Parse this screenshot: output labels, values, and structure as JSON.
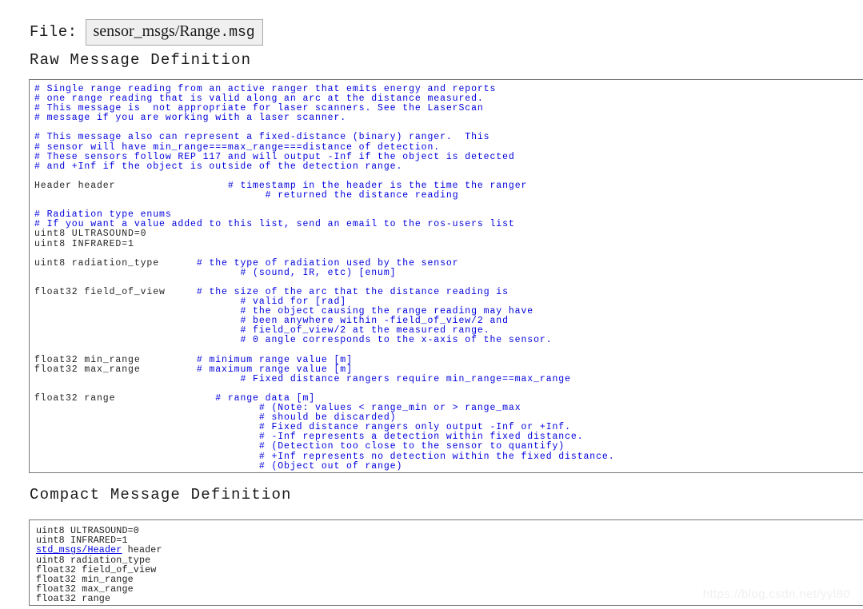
{
  "page": {
    "file_label": "File:",
    "file_name_stem": "sensor_msgs/Range",
    "file_name_ext": ".msg",
    "file_name_full": "sensor_msgs/Range.msg",
    "watermark": "https://blog.csdn.net/yyl80"
  },
  "colors": {
    "comment_blue": "#0000dd",
    "code_text": "#222222",
    "link_blue": "#0000dd",
    "box_border": "#777777",
    "file_box_bg": "#efefef",
    "file_box_border": "#a9a9a9",
    "watermark": "#f0f0f0",
    "page_bg": "#ffffff"
  },
  "sections": {
    "raw": {
      "heading": "Raw Message Definition",
      "lines": [
        {
          "code": "",
          "comment": "# Single range reading from an active ranger that emits energy and reports"
        },
        {
          "code": "",
          "comment": "# one range reading that is valid along an arc at the distance measured."
        },
        {
          "code": "",
          "comment": "# This message is  not appropriate for laser scanners. See the LaserScan"
        },
        {
          "code": "",
          "comment": "# message if you are working with a laser scanner."
        },
        {
          "code": "",
          "comment": ""
        },
        {
          "code": "",
          "comment": "# This message also can represent a fixed-distance (binary) ranger.  This"
        },
        {
          "code": "",
          "comment": "# sensor will have min_range===max_range===distance of detection."
        },
        {
          "code": "",
          "comment": "# These sensors follow REP 117 and will output -Inf if the object is detected"
        },
        {
          "code": "",
          "comment": "# and +Inf if the object is outside of the detection range."
        },
        {
          "code": "",
          "comment": ""
        },
        {
          "code": "Header header",
          "comment": "# timestamp in the header is the time the ranger"
        },
        {
          "code": "",
          "comment": "# returned the distance reading"
        },
        {
          "code": "",
          "comment": ""
        },
        {
          "code": "",
          "comment": "# Radiation type enums"
        },
        {
          "code": "",
          "comment": "# If you want a value added to this list, send an email to the ros-users list"
        },
        {
          "code": "uint8 ULTRASOUND=0",
          "comment": ""
        },
        {
          "code": "uint8 INFRARED=1",
          "comment": ""
        },
        {
          "code": "",
          "comment": ""
        },
        {
          "code": "uint8 radiation_type",
          "comment": "# the type of radiation used by the sensor"
        },
        {
          "code": "",
          "comment": "# (sound, IR, etc) [enum]"
        },
        {
          "code": "",
          "comment": ""
        },
        {
          "code": "float32 field_of_view",
          "comment": "# the size of the arc that the distance reading is"
        },
        {
          "code": "",
          "comment": "# valid for [rad]"
        },
        {
          "code": "",
          "comment": "# the object causing the range reading may have"
        },
        {
          "code": "",
          "comment": "# been anywhere within -field_of_view/2 and"
        },
        {
          "code": "",
          "comment": "# field_of_view/2 at the measured range."
        },
        {
          "code": "",
          "comment": "# 0 angle corresponds to the x-axis of the sensor."
        },
        {
          "code": "",
          "comment": ""
        },
        {
          "code": "float32 min_range",
          "comment": "# minimum range value [m]"
        },
        {
          "code": "float32 max_range",
          "comment": "# maximum range value [m]"
        },
        {
          "code": "",
          "comment": "# Fixed distance rangers require min_range==max_range"
        },
        {
          "code": "",
          "comment": ""
        },
        {
          "code": "float32 range",
          "comment": "# range data [m]"
        },
        {
          "code": "",
          "comment": "# (Note: values < range_min or > range_max"
        },
        {
          "code": "",
          "comment": "# should be discarded)"
        },
        {
          "code": "",
          "comment": "# Fixed distance rangers only output -Inf or +Inf."
        },
        {
          "code": "",
          "comment": "# -Inf represents a detection within fixed distance."
        },
        {
          "code": "",
          "comment": "# (Detection too close to the sensor to quantify)"
        },
        {
          "code": "",
          "comment": "# +Inf represents no detection within the fixed distance."
        },
        {
          "code": "",
          "comment": "# (Object out of range)"
        }
      ],
      "text": "#  Single  range  reading  from  an  active  ranger  that  emits  energy  and  reports\n#  one  range  reading  that  is  valid  along  an  arc  at  the  distance  measured.\n#  This  message  is   not  appropriate  for  laser  scanners.  See  the  LaserScan\n#  message  if  you  are  working  with  a  laser  scanner.\n\n#  This  message  also  can  represent  a  fixed-distance  (binary)  ranger.   This\n#  sensor  will  have  min_range==max_range==distance  of  detection.\n#  These  sensors  follow  REP  117  and  will  output  -Inf  if  the  object  is  detected\n#  and  +Inf  if  the  object  is  outside  of  the  detection  range."
    },
    "compact": {
      "heading": "Compact Message Definition",
      "lines": [
        {
          "text": "uint8 ULTRASOUND=0",
          "link": false
        },
        {
          "text": "uint8 INFRARED=1",
          "link": false
        },
        {
          "text": "std_msgs/Header",
          "suffix": " header",
          "link": true
        },
        {
          "text": "uint8 radiation_type",
          "link": false
        },
        {
          "text": "float32 field_of_view",
          "link": false
        },
        {
          "text": "float32 min_range",
          "link": false
        },
        {
          "text": "float32 max_range",
          "link": false
        },
        {
          "text": "float32 range",
          "link": false
        }
      ]
    }
  }
}
